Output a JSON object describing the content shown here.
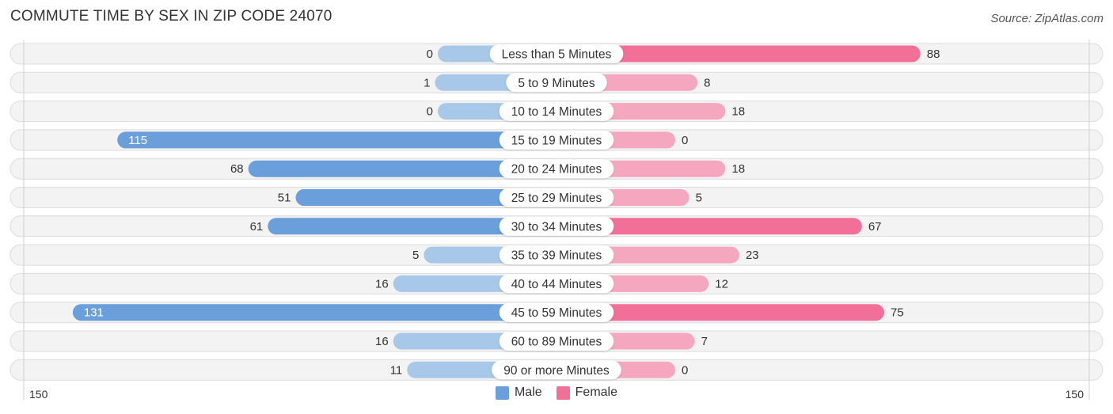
{
  "header": {
    "title": "COMMUTE TIME BY SEX IN ZIP CODE 24070",
    "source": "Source: ZipAtlas.com"
  },
  "colors": {
    "male_strong": "#6a9fdb",
    "male_light": "#a8c8ea",
    "female_strong": "#f27098",
    "female_light": "#f6a7c0"
  },
  "legend": [
    {
      "label": "Male",
      "color": "#6a9fdb"
    },
    {
      "label": "Female",
      "color": "#f27098"
    }
  ],
  "axis": {
    "left_label": "150",
    "right_label": "150"
  },
  "chart_data": {
    "type": "bar",
    "orientation": "horizontal-diverging",
    "title": "COMMUTE TIME BY SEX IN ZIP CODE 24070",
    "xlabel": "",
    "ylabel": "",
    "xlim": [
      -150,
      150
    ],
    "legend_position": "bottom-center",
    "categories": [
      "Less than 5 Minutes",
      "5 to 9 Minutes",
      "10 to 14 Minutes",
      "15 to 19 Minutes",
      "20 to 24 Minutes",
      "25 to 29 Minutes",
      "30 to 34 Minutes",
      "35 to 39 Minutes",
      "40 to 44 Minutes",
      "45 to 59 Minutes",
      "60 to 89 Minutes",
      "90 or more Minutes"
    ],
    "series": [
      {
        "name": "Male",
        "values": [
          0,
          1,
          0,
          115,
          68,
          51,
          61,
          5,
          16,
          131,
          16,
          11
        ]
      },
      {
        "name": "Female",
        "values": [
          88,
          8,
          18,
          0,
          18,
          5,
          67,
          23,
          12,
          75,
          7,
          0
        ]
      }
    ],
    "tick_labels": [
      "150",
      "150"
    ]
  }
}
